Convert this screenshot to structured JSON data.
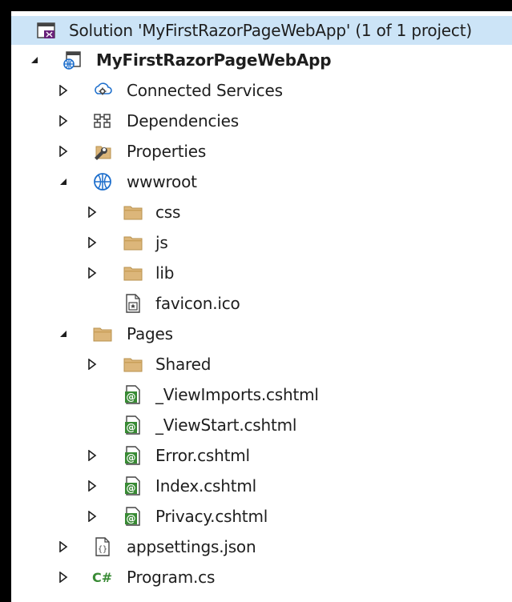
{
  "solution": {
    "label": "Solution 'MyFirstRazorPageWebApp' (1 of 1 project)"
  },
  "tree": [
    {
      "label": "MyFirstRazorPageWebApp",
      "icon": "web-project-icon",
      "expanded": true,
      "bold": true
    },
    {
      "label": "Connected Services",
      "icon": "connected-services-icon",
      "expanded": false
    },
    {
      "label": "Dependencies",
      "icon": "dependencies-icon",
      "expanded": false
    },
    {
      "label": "Properties",
      "icon": "properties-wrench-icon",
      "expanded": false
    },
    {
      "label": "wwwroot",
      "icon": "globe-icon",
      "expanded": true
    },
    {
      "label": "css",
      "icon": "folder-icon",
      "expanded": false
    },
    {
      "label": "js",
      "icon": "folder-icon",
      "expanded": false
    },
    {
      "label": "lib",
      "icon": "folder-icon",
      "expanded": false
    },
    {
      "label": "favicon.ico",
      "icon": "image-file-icon"
    },
    {
      "label": "Pages",
      "icon": "folder-icon",
      "expanded": true
    },
    {
      "label": "Shared",
      "icon": "folder-icon",
      "expanded": false
    },
    {
      "label": "_ViewImports.cshtml",
      "icon": "razor-file-icon"
    },
    {
      "label": "_ViewStart.cshtml",
      "icon": "razor-file-icon"
    },
    {
      "label": "Error.cshtml",
      "icon": "razor-file-icon",
      "expanded": false
    },
    {
      "label": "Index.cshtml",
      "icon": "razor-file-icon",
      "expanded": false
    },
    {
      "label": "Privacy.cshtml",
      "icon": "razor-file-icon",
      "expanded": false
    },
    {
      "label": "appsettings.json",
      "icon": "json-file-icon",
      "expanded": false
    },
    {
      "label": "Program.cs",
      "icon": "csharp-file-icon",
      "expanded": false
    }
  ],
  "colors": {
    "selection": "#cce4f7",
    "folder": "#dcb67a",
    "razor": "#388a34",
    "globe": "#1e6fcc",
    "csharp": "#388a34"
  }
}
